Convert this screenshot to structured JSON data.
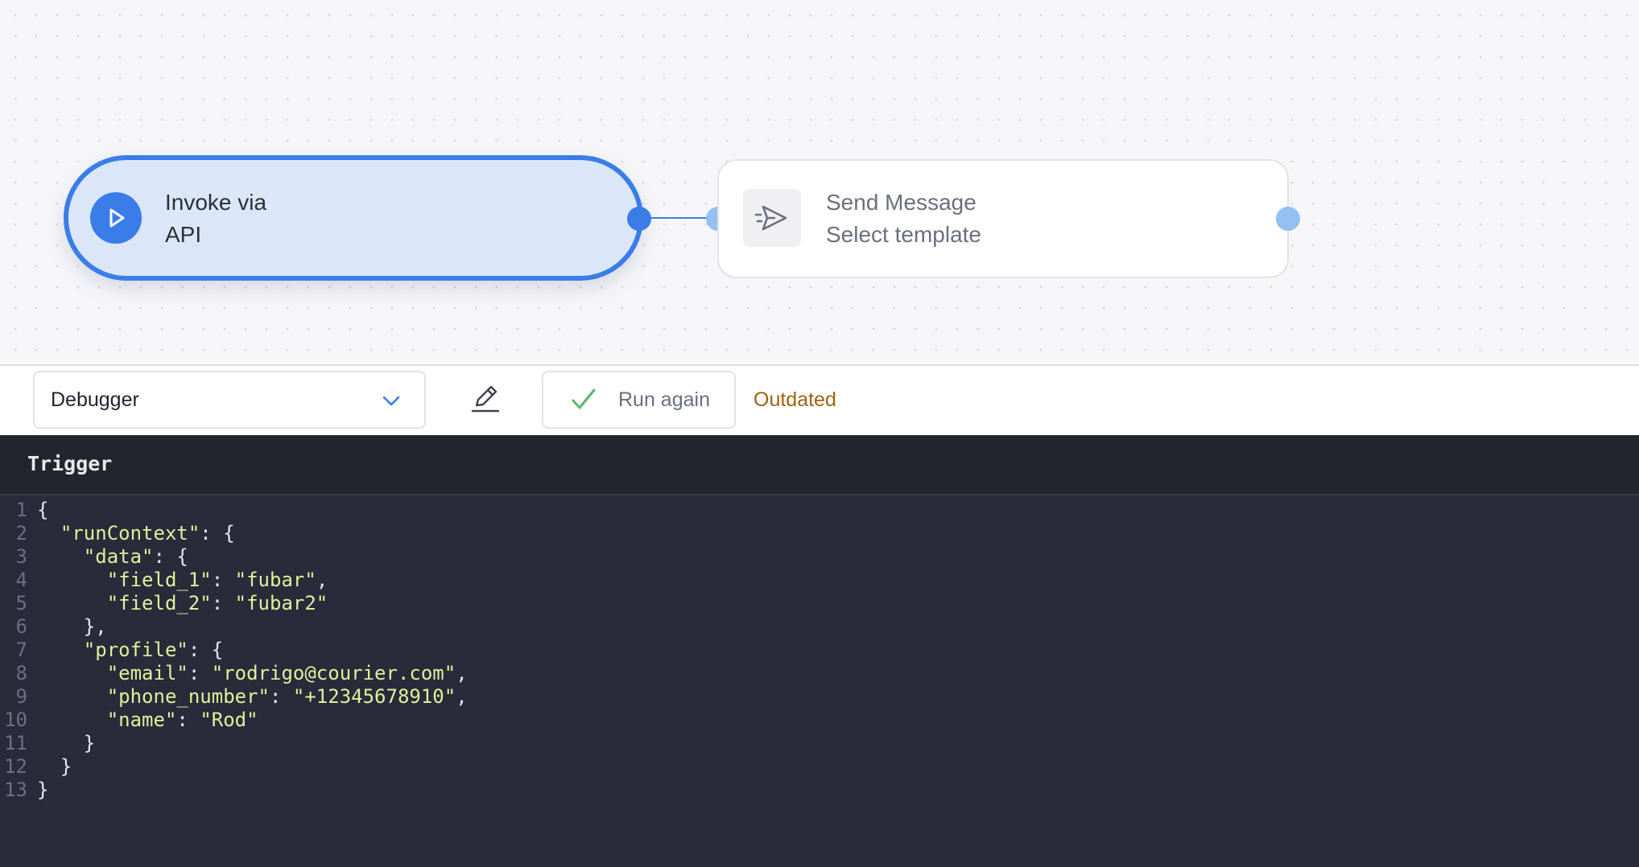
{
  "canvas": {
    "trigger_node": {
      "title": "Invoke via API",
      "icon": "play-icon",
      "accent": "#3a7de8"
    },
    "action_node": {
      "title": "Send Message",
      "subtitle": "Select template",
      "icon": "send-icon"
    }
  },
  "toolbar": {
    "dropdown_value": "Debugger",
    "edit_icon": "pencil-icon",
    "run_label": "Run again",
    "run_icon": "check-icon",
    "status": "Outdated",
    "status_color": "#9b6211"
  },
  "panel": {
    "title": "Trigger",
    "lines": [
      "{",
      "  \"runContext\": {",
      "    \"data\": {",
      "      \"field_1\": \"fubar\",",
      "      \"field_2\": \"fubar2\"",
      "    },",
      "    \"profile\": {",
      "      \"email\": \"rodrigo@courier.com\",",
      "      \"phone_number\": \"+12345678910\",",
      "      \"name\": \"Rod\"",
      "    }",
      "  }",
      "}"
    ]
  }
}
